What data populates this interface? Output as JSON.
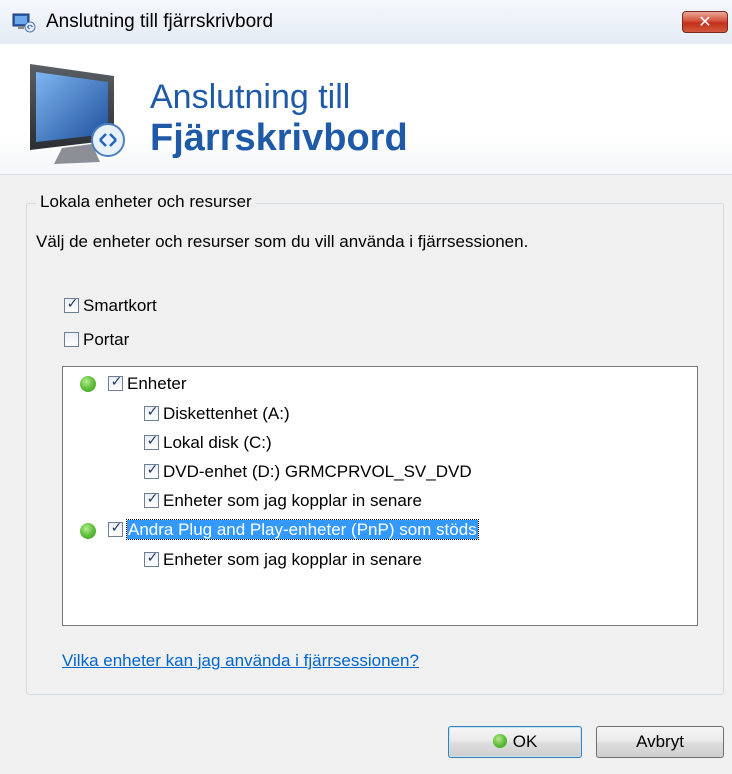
{
  "window": {
    "title": "Anslutning till fjärrskrivbord",
    "close_label": "✕"
  },
  "banner": {
    "line1": "Anslutning till",
    "line2": "Fjärrskrivbord"
  },
  "group": {
    "legend": "Lokala enheter och resurser",
    "instruction": "Välj de enheter och resurser som du vill använda i fjärrsessionen."
  },
  "options": [
    {
      "label": "Smartkort",
      "checked": true
    },
    {
      "label": "Portar",
      "checked": false
    }
  ],
  "tree": {
    "enheter": {
      "label": "Enheter",
      "checked": true
    },
    "enheter_children": [
      {
        "label": "Diskettenhet (A:)",
        "checked": true
      },
      {
        "label": "Lokal disk (C:)",
        "checked": true
      },
      {
        "label": "DVD-enhet (D:) GRMCPRVOL_SV_DVD",
        "checked": true
      },
      {
        "label": "Enheter som jag kopplar in senare",
        "checked": true
      }
    ],
    "pnp": {
      "label": "Andra Plug and Play-enheter (PnP) som stöds",
      "checked": true,
      "selected": true
    },
    "pnp_children": [
      {
        "label": "Enheter som jag kopplar in senare",
        "checked": true
      }
    ]
  },
  "help_link": "Vilka enheter kan jag använda i fjärrsessionen?",
  "buttons": {
    "ok": "OK",
    "cancel": "Avbryt"
  },
  "colors": {
    "banner_text": "#1e5aa8",
    "link": "#0066cc",
    "selection": "#3399ff",
    "status_dot": "#5fbf3a"
  },
  "icons": {
    "app": "remote-desktop-icon",
    "banner": "monitor-remote-icon",
    "check": "✓"
  }
}
